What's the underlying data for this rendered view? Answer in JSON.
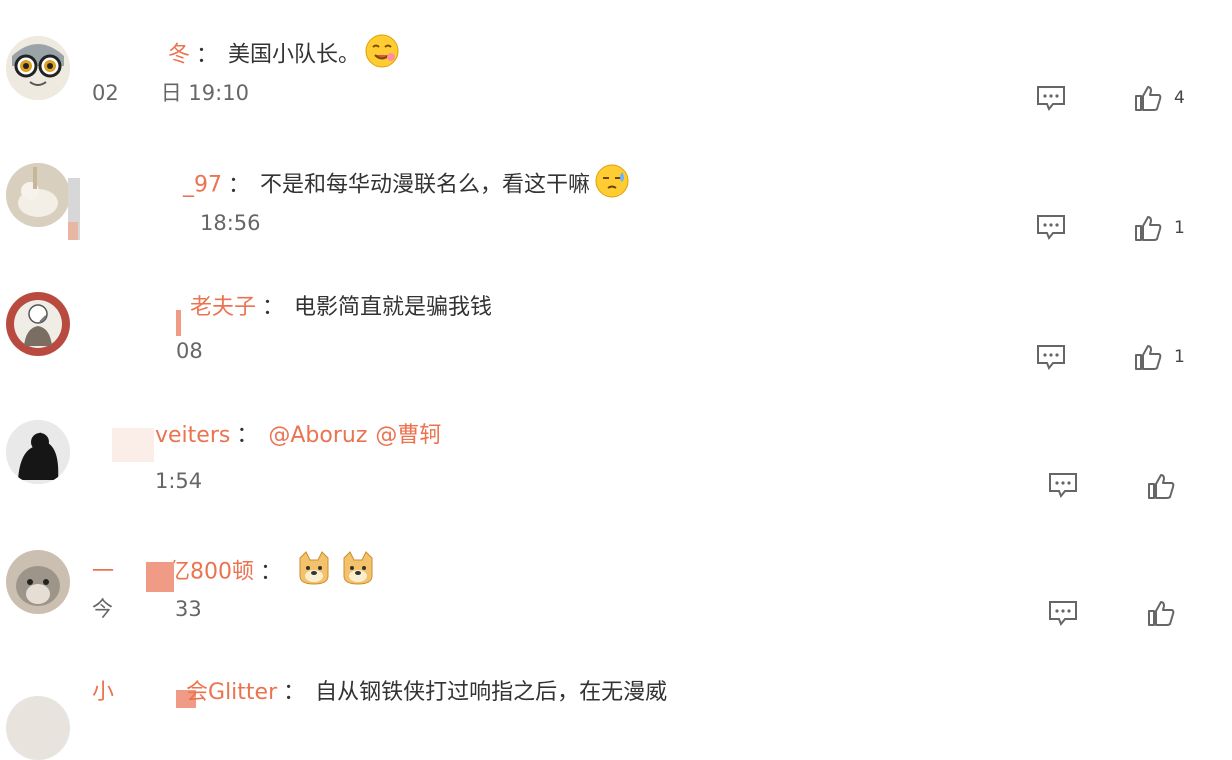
{
  "comments": [
    {
      "user": "冬",
      "sep": "：",
      "text": "美国小队长。",
      "time_a": "02",
      "time_b": "日 19:10",
      "likes": "4",
      "emoji": "smile-face"
    },
    {
      "user": "_97",
      "sep": "：",
      "text": "不是和每华动漫联名么，看这干嘛",
      "time": "18:56",
      "likes": "1",
      "emoji": "sweat-face"
    },
    {
      "user": "老夫子",
      "sep": "：",
      "text": "电影简直就是骗我钱",
      "time": "08",
      "likes": "1"
    },
    {
      "user": "veiters",
      "sep": "：",
      "mention1": "@Aboruz",
      "mention2": "@曹轲",
      "time": "1:54",
      "likes": ""
    },
    {
      "user": "一",
      "user2": "亿800顿",
      "sep": "：",
      "time_a": "今",
      "time_b": "33",
      "likes": "",
      "emoji": "doge-face"
    },
    {
      "user": "小",
      "user2": "会Glitter",
      "sep": "：",
      "text": "自从钢铁侠打过响指之后，在无漫威"
    }
  ],
  "colors": {
    "username": "#eb7350",
    "text": "#333333",
    "meta": "#666666",
    "icon": "#666666"
  }
}
